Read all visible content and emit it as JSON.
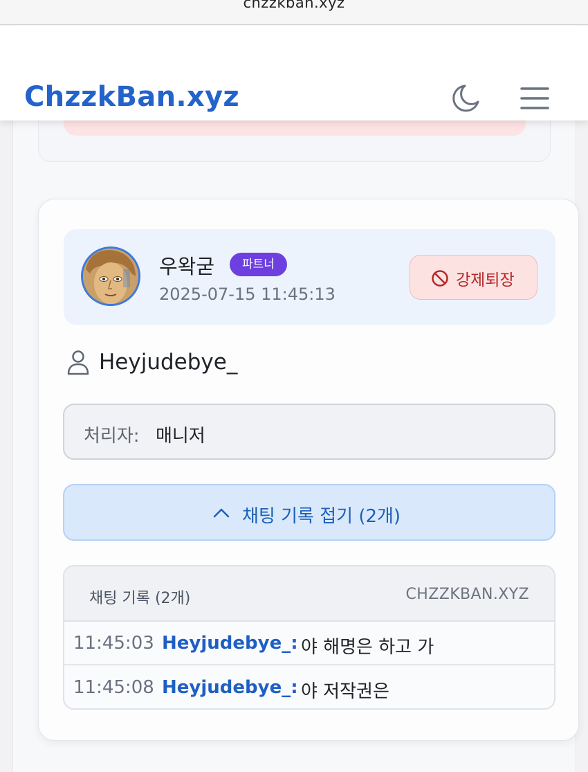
{
  "browser": {
    "url": "chzzkban.xyz"
  },
  "navbar": {
    "brand": "ChzzkBan.xyz",
    "theme_icon": "moon-icon",
    "menu_icon": "hamburger-menu-icon"
  },
  "card": {
    "user": {
      "nickname": "우왁굳",
      "badge": "파트너",
      "timestamp": "2025-07-15 11:45:13"
    },
    "action": {
      "label": "강제퇴장",
      "icon": "ban-icon"
    },
    "target": {
      "icon": "user-icon",
      "name": "Heyjudebye_"
    },
    "handler": {
      "label": "처리자:",
      "value": "매니저"
    },
    "collapse_button": {
      "icon": "chevron-up-icon",
      "label": "채팅 기록 접기 (2개)"
    },
    "chat_log": {
      "title": "채팅 기록 (2개)",
      "brand": "CHZZKBAN.XYZ",
      "rows": [
        {
          "time": "11:45:03",
          "user": "Heyjudebye_:",
          "message": "야 해명은 하고 가"
        },
        {
          "time": "11:45:08",
          "user": "Heyjudebye_:",
          "message": "야 저작권은"
        }
      ]
    }
  },
  "colors": {
    "brand": "#2463c9",
    "badge": "#6d3fe0",
    "kick": "#b42828",
    "link": "#1f5fc4"
  }
}
